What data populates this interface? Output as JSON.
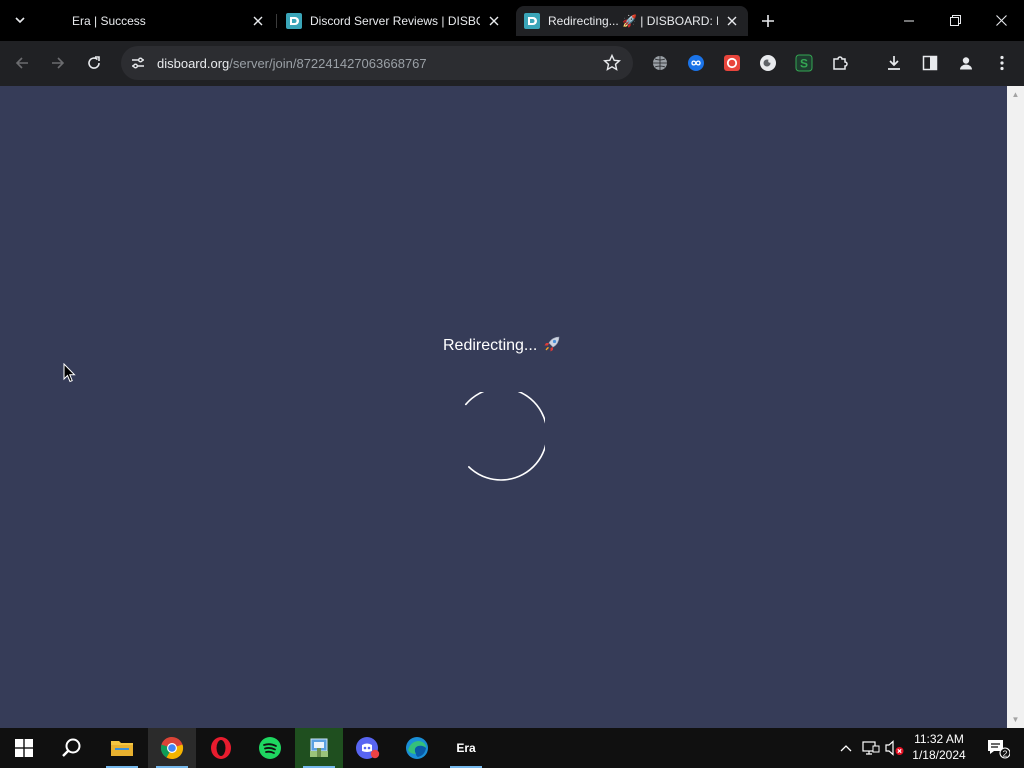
{
  "tabs": [
    {
      "title": "Era | Success",
      "favicon": "none",
      "active": false
    },
    {
      "title": "Discord Server Reviews | DISBOARD",
      "favicon": "disboard-icon",
      "active": false
    },
    {
      "title": "Redirecting... 🚀 | DISBOARD: Discord Server List",
      "favicon": "disboard-icon",
      "active": true
    }
  ],
  "address_bar": {
    "domain": "disboard.org",
    "path": "/server/join/872241427063668767"
  },
  "page": {
    "message": "Redirecting...",
    "background": "#363c58"
  },
  "taskbar": {
    "apps": [
      "windows-start",
      "search",
      "file-explorer",
      "chrome",
      "opera",
      "spotify",
      "app-installer",
      "discord-app",
      "edge",
      "era"
    ],
    "era_label": "Era",
    "time": "11:32 AM",
    "date": "1/18/2024",
    "notification_count": "2"
  }
}
